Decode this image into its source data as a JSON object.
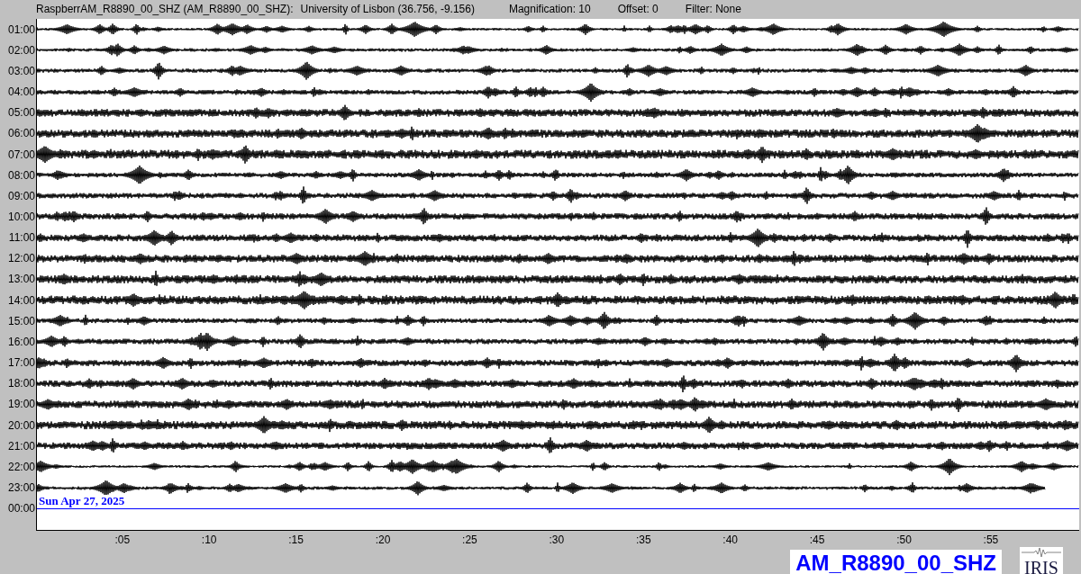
{
  "header": {
    "station": "RaspberrAM_R8890_00_SHZ (AM_R8890_00_SHZ):",
    "location": "University of Lisbon (36.756, -9.156)",
    "magnification": "Magnification: 10",
    "offset": "Offset: 0",
    "filter": "Filter: None"
  },
  "rows": [
    {
      "label": "01:00",
      "kind": "trace"
    },
    {
      "label": "02:00",
      "kind": "trace"
    },
    {
      "label": "03:00",
      "kind": "trace"
    },
    {
      "label": "04:00",
      "kind": "trace"
    },
    {
      "label": "05:00",
      "kind": "trace"
    },
    {
      "label": "06:00",
      "kind": "trace"
    },
    {
      "label": "07:00",
      "kind": "trace"
    },
    {
      "label": "08:00",
      "kind": "trace"
    },
    {
      "label": "09:00",
      "kind": "trace"
    },
    {
      "label": "10:00",
      "kind": "trace"
    },
    {
      "label": "11:00",
      "kind": "trace"
    },
    {
      "label": "12:00",
      "kind": "trace"
    },
    {
      "label": "13:00",
      "kind": "trace"
    },
    {
      "label": "14:00",
      "kind": "trace"
    },
    {
      "label": "15:00",
      "kind": "trace"
    },
    {
      "label": "16:00",
      "kind": "trace"
    },
    {
      "label": "17:00",
      "kind": "trace"
    },
    {
      "label": "18:00",
      "kind": "trace"
    },
    {
      "label": "19:00",
      "kind": "trace"
    },
    {
      "label": "20:00",
      "kind": "trace"
    },
    {
      "label": "21:00",
      "kind": "trace"
    },
    {
      "label": "22:00",
      "kind": "trace"
    },
    {
      "label": "23:00",
      "kind": "partial"
    },
    {
      "label": "00:00",
      "kind": "now"
    }
  ],
  "date": "Sun Apr 27, 2025",
  "xticks": [
    ":05",
    ":10",
    ":15",
    ":20",
    ":25",
    ":30",
    ":35",
    ":40",
    ":45",
    ":50",
    ":55"
  ],
  "station_badge": "AM_R8890_00_SHZ",
  "logo": "IRIS"
}
